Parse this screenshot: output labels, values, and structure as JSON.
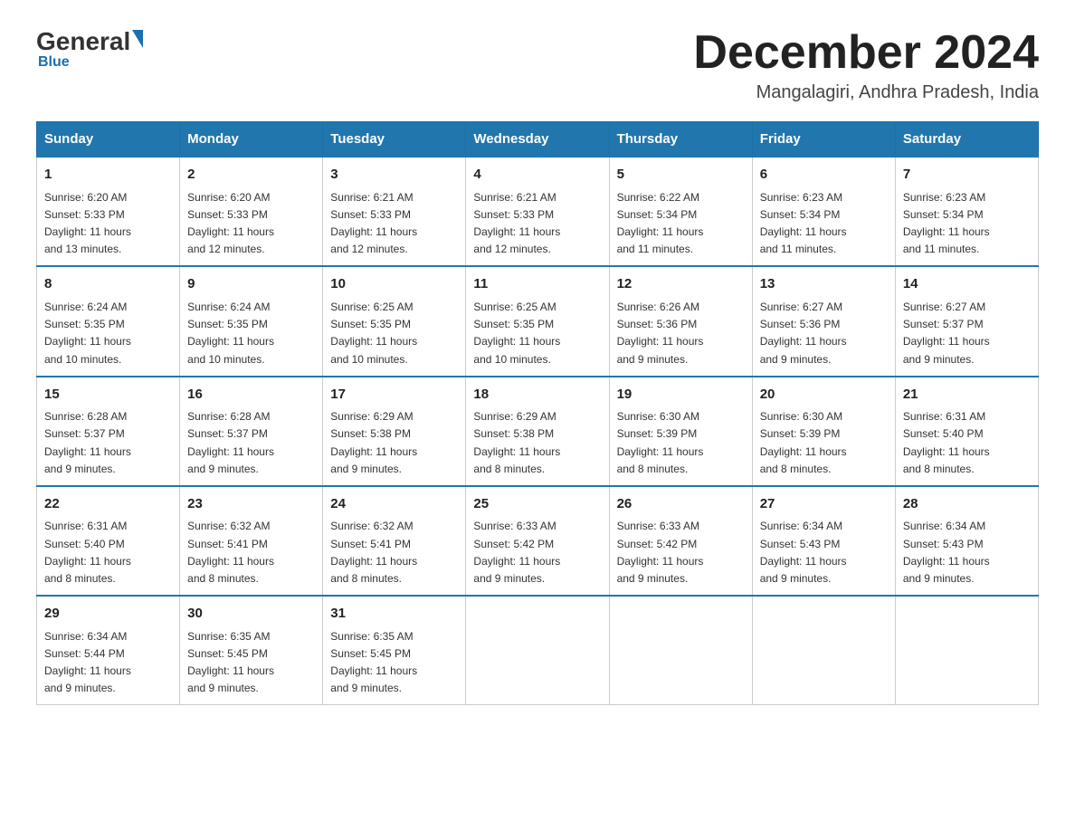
{
  "header": {
    "logo_general": "General",
    "logo_blue": "Blue",
    "month_title": "December 2024",
    "location": "Mangalagiri, Andhra Pradesh, India"
  },
  "days_of_week": [
    "Sunday",
    "Monday",
    "Tuesday",
    "Wednesday",
    "Thursday",
    "Friday",
    "Saturday"
  ],
  "weeks": [
    [
      {
        "day": "1",
        "sunrise": "6:20 AM",
        "sunset": "5:33 PM",
        "daylight": "11 hours and 13 minutes."
      },
      {
        "day": "2",
        "sunrise": "6:20 AM",
        "sunset": "5:33 PM",
        "daylight": "11 hours and 12 minutes."
      },
      {
        "day": "3",
        "sunrise": "6:21 AM",
        "sunset": "5:33 PM",
        "daylight": "11 hours and 12 minutes."
      },
      {
        "day": "4",
        "sunrise": "6:21 AM",
        "sunset": "5:33 PM",
        "daylight": "11 hours and 12 minutes."
      },
      {
        "day": "5",
        "sunrise": "6:22 AM",
        "sunset": "5:34 PM",
        "daylight": "11 hours and 11 minutes."
      },
      {
        "day": "6",
        "sunrise": "6:23 AM",
        "sunset": "5:34 PM",
        "daylight": "11 hours and 11 minutes."
      },
      {
        "day": "7",
        "sunrise": "6:23 AM",
        "sunset": "5:34 PM",
        "daylight": "11 hours and 11 minutes."
      }
    ],
    [
      {
        "day": "8",
        "sunrise": "6:24 AM",
        "sunset": "5:35 PM",
        "daylight": "11 hours and 10 minutes."
      },
      {
        "day": "9",
        "sunrise": "6:24 AM",
        "sunset": "5:35 PM",
        "daylight": "11 hours and 10 minutes."
      },
      {
        "day": "10",
        "sunrise": "6:25 AM",
        "sunset": "5:35 PM",
        "daylight": "11 hours and 10 minutes."
      },
      {
        "day": "11",
        "sunrise": "6:25 AM",
        "sunset": "5:35 PM",
        "daylight": "11 hours and 10 minutes."
      },
      {
        "day": "12",
        "sunrise": "6:26 AM",
        "sunset": "5:36 PM",
        "daylight": "11 hours and 9 minutes."
      },
      {
        "day": "13",
        "sunrise": "6:27 AM",
        "sunset": "5:36 PM",
        "daylight": "11 hours and 9 minutes."
      },
      {
        "day": "14",
        "sunrise": "6:27 AM",
        "sunset": "5:37 PM",
        "daylight": "11 hours and 9 minutes."
      }
    ],
    [
      {
        "day": "15",
        "sunrise": "6:28 AM",
        "sunset": "5:37 PM",
        "daylight": "11 hours and 9 minutes."
      },
      {
        "day": "16",
        "sunrise": "6:28 AM",
        "sunset": "5:37 PM",
        "daylight": "11 hours and 9 minutes."
      },
      {
        "day": "17",
        "sunrise": "6:29 AM",
        "sunset": "5:38 PM",
        "daylight": "11 hours and 9 minutes."
      },
      {
        "day": "18",
        "sunrise": "6:29 AM",
        "sunset": "5:38 PM",
        "daylight": "11 hours and 8 minutes."
      },
      {
        "day": "19",
        "sunrise": "6:30 AM",
        "sunset": "5:39 PM",
        "daylight": "11 hours and 8 minutes."
      },
      {
        "day": "20",
        "sunrise": "6:30 AM",
        "sunset": "5:39 PM",
        "daylight": "11 hours and 8 minutes."
      },
      {
        "day": "21",
        "sunrise": "6:31 AM",
        "sunset": "5:40 PM",
        "daylight": "11 hours and 8 minutes."
      }
    ],
    [
      {
        "day": "22",
        "sunrise": "6:31 AM",
        "sunset": "5:40 PM",
        "daylight": "11 hours and 8 minutes."
      },
      {
        "day": "23",
        "sunrise": "6:32 AM",
        "sunset": "5:41 PM",
        "daylight": "11 hours and 8 minutes."
      },
      {
        "day": "24",
        "sunrise": "6:32 AM",
        "sunset": "5:41 PM",
        "daylight": "11 hours and 8 minutes."
      },
      {
        "day": "25",
        "sunrise": "6:33 AM",
        "sunset": "5:42 PM",
        "daylight": "11 hours and 9 minutes."
      },
      {
        "day": "26",
        "sunrise": "6:33 AM",
        "sunset": "5:42 PM",
        "daylight": "11 hours and 9 minutes."
      },
      {
        "day": "27",
        "sunrise": "6:34 AM",
        "sunset": "5:43 PM",
        "daylight": "11 hours and 9 minutes."
      },
      {
        "day": "28",
        "sunrise": "6:34 AM",
        "sunset": "5:43 PM",
        "daylight": "11 hours and 9 minutes."
      }
    ],
    [
      {
        "day": "29",
        "sunrise": "6:34 AM",
        "sunset": "5:44 PM",
        "daylight": "11 hours and 9 minutes."
      },
      {
        "day": "30",
        "sunrise": "6:35 AM",
        "sunset": "5:45 PM",
        "daylight": "11 hours and 9 minutes."
      },
      {
        "day": "31",
        "sunrise": "6:35 AM",
        "sunset": "5:45 PM",
        "daylight": "11 hours and 9 minutes."
      },
      null,
      null,
      null,
      null
    ]
  ],
  "labels": {
    "sunrise": "Sunrise:",
    "sunset": "Sunset:",
    "daylight": "Daylight:"
  }
}
